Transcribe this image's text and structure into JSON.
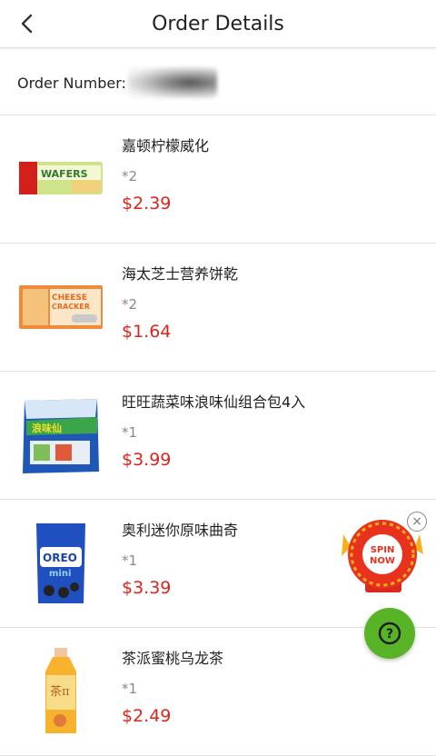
{
  "header": {
    "title": "Order Details"
  },
  "order": {
    "label": "Order Number:"
  },
  "items": [
    {
      "name": "嘉顿柠檬威化",
      "qty": "*2",
      "price": "$2.39",
      "thumb_text": "WAFERS"
    },
    {
      "name": "海太芝士营养饼乾",
      "qty": "*2",
      "price": "$1.64",
      "thumb_text": "CHEESE CRACKER"
    },
    {
      "name": "旺旺蔬菜味浪味仙组合包4入",
      "qty": "*1",
      "price": "$3.99",
      "thumb_text": "浪味仙"
    },
    {
      "name": "奥利迷你原味曲奇",
      "qty": "*1",
      "price": "$3.39",
      "thumb_text": "OREO mini"
    },
    {
      "name": "茶派蜜桃乌龙茶",
      "qty": "*1",
      "price": "$2.49",
      "thumb_text": "茶π"
    }
  ],
  "spin": {
    "label_line1": "SPIN",
    "label_line2": "NOW",
    "close": "×"
  },
  "help": {
    "label": "?"
  },
  "colors": {
    "price": "#d9251c",
    "help_button": "#58b326",
    "spin_red": "#e8321e",
    "spin_gold": "#f6b21a"
  }
}
